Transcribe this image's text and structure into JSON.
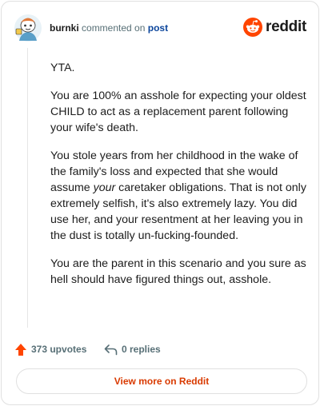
{
  "comment": {
    "username": "burnki",
    "verb": "commented on",
    "post_link": "post",
    "paragraphs": [
      [
        "YTA."
      ],
      [
        "You are 100% an asshole for expecting your oldest CHILD to act as a replacement parent following your wife's death."
      ],
      [
        "You stole years from her childhood in the wake of the family's loss and expected that she would assume ",
        "your",
        " caretaker obligations. That is not only extremely selfish, it's also extremely lazy. You did use her, and your resentment at her leaving you in the dust is totally un-fucking-founded."
      ],
      [
        "You are the parent in this scenario and you sure as hell should have figured things out, asshole."
      ]
    ]
  },
  "brand": {
    "wordmark": "reddit",
    "color": "#ff4500"
  },
  "actions": {
    "upvotes_label": "373 upvotes",
    "replies_label": "0 replies",
    "upvote_icon": "upvote-arrow-icon",
    "reply_icon": "reply-arrow-icon"
  },
  "footer": {
    "view_more_label": "View more on Reddit"
  },
  "colors": {
    "accent": "#d93a00",
    "upvote": "#ff4500",
    "link": "#0a449b",
    "muted": "#576f76"
  }
}
